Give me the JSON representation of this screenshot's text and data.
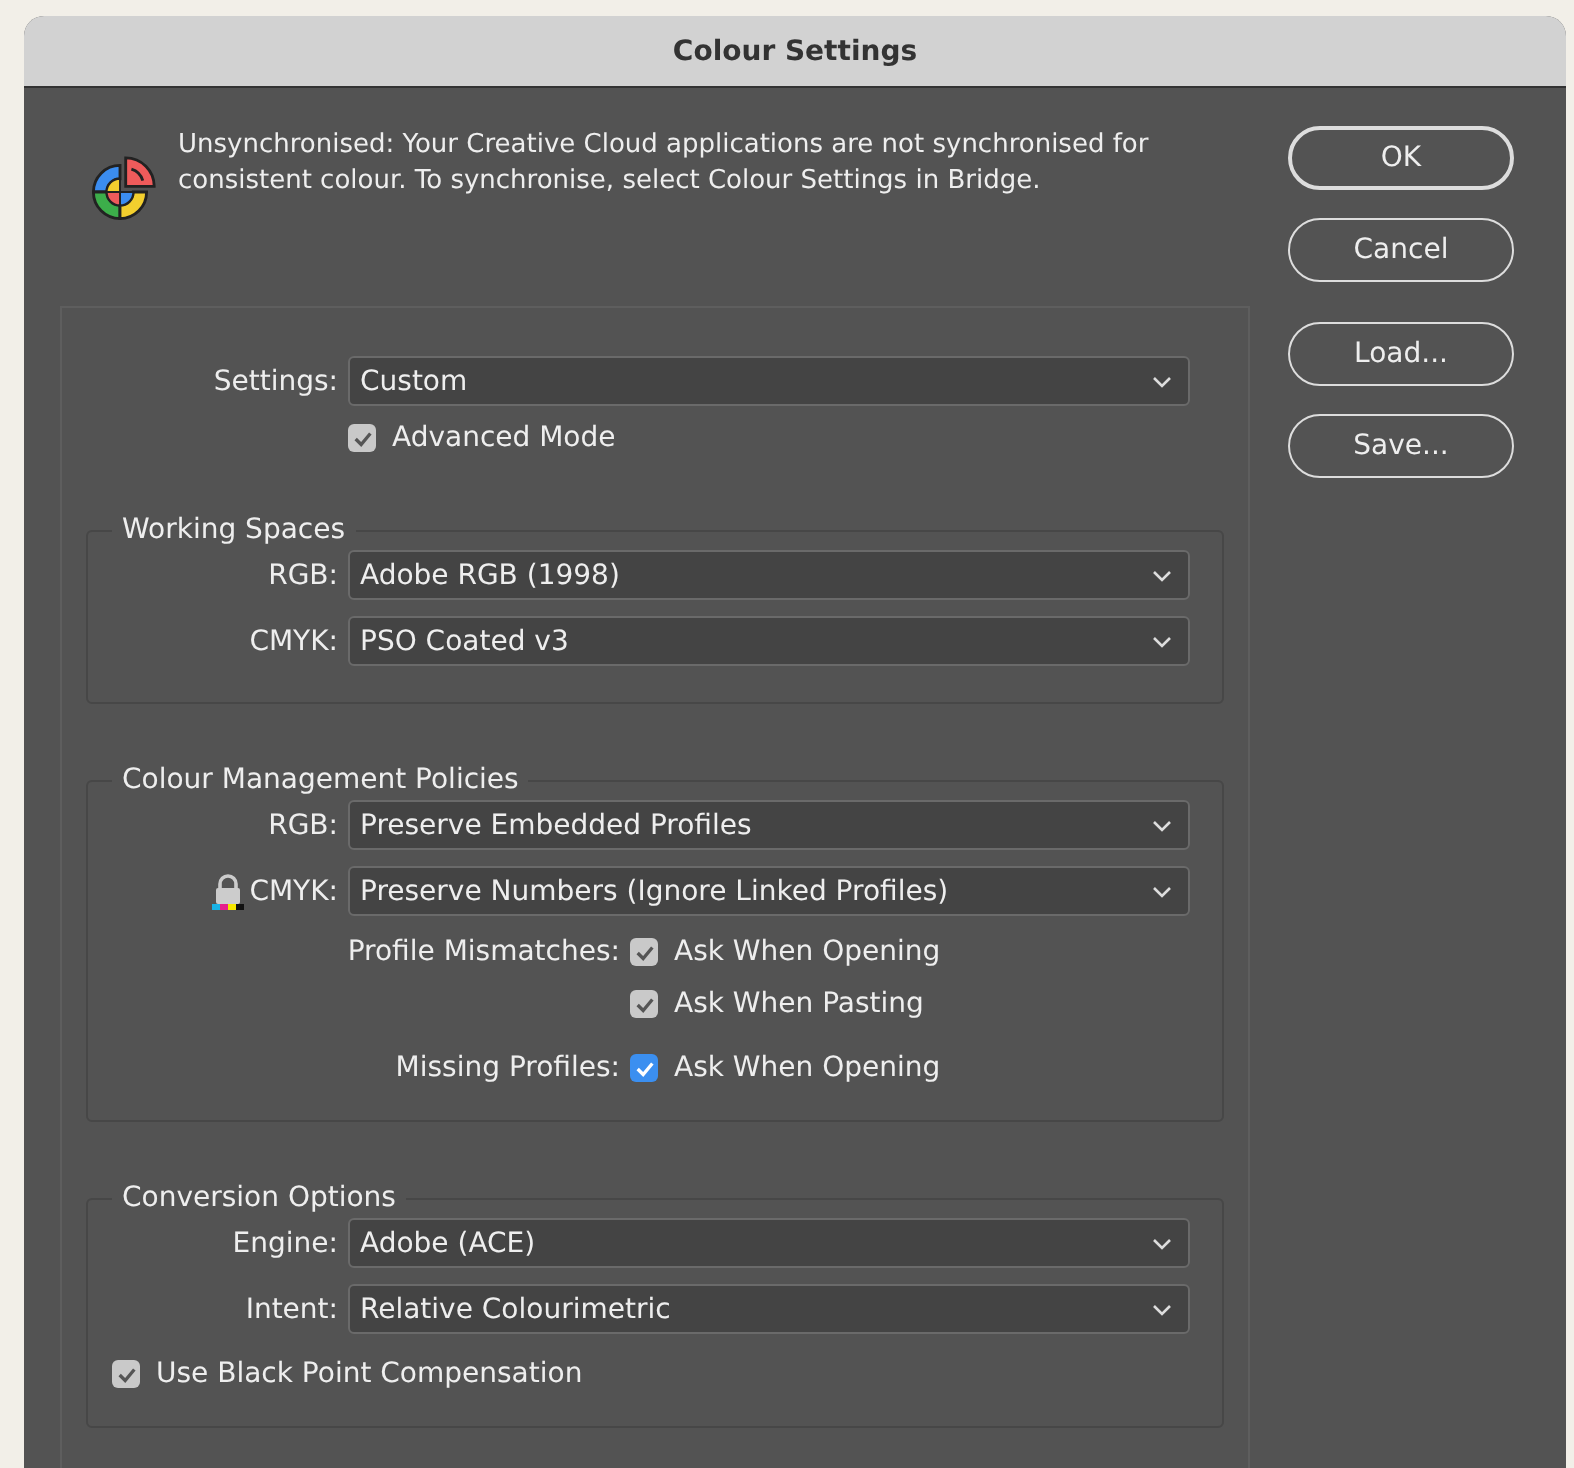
{
  "window": {
    "title": "Colour Settings"
  },
  "message": "Unsynchronised: Your Creative Cloud applications are not synchronised for consistent colour. To synchronise, select Colour Settings in Bridge.",
  "buttons": [
    {
      "label": "OK",
      "default": true
    },
    {
      "label": "Cancel",
      "default": false
    },
    {
      "label": "Load...",
      "default": false
    },
    {
      "label": "Save...",
      "default": false
    }
  ],
  "settings": {
    "label": "Settings:",
    "value": "Custom"
  },
  "advanced_mode": {
    "label": "Advanced Mode",
    "checked": true,
    "focused": false
  },
  "groups": [
    {
      "title": "Working Spaces",
      "rows": [
        {
          "kind": "select",
          "label": "RGB:",
          "value": "Adobe RGB (1998)",
          "locked": false
        },
        {
          "kind": "select",
          "label": "CMYK:",
          "value": "PSO Coated v3",
          "locked": false
        }
      ]
    },
    {
      "title": "Colour Management Policies",
      "rows": [
        {
          "kind": "select",
          "label": "RGB:",
          "value": "Preserve Embedded Profiles",
          "locked": false
        },
        {
          "kind": "select",
          "label": "CMYK:",
          "value": "Preserve Numbers (Ignore Linked Profiles)",
          "locked": true
        },
        {
          "kind": "checkbox",
          "label": "Profile Mismatches:",
          "text": "Ask When Opening",
          "checked": true,
          "focused": false
        },
        {
          "kind": "checkbox",
          "text": "Ask When Pasting",
          "checked": true,
          "focused": false
        },
        {
          "kind": "checkbox",
          "label": "Missing Profiles:",
          "text": "Ask When Opening",
          "checked": true,
          "focused": true
        }
      ]
    },
    {
      "title": "Conversion Options",
      "rows": [
        {
          "kind": "select",
          "label": "Engine:",
          "value": "Adobe (ACE)",
          "locked": false
        },
        {
          "kind": "select",
          "label": "Intent:",
          "value": "Relative Colourimetric",
          "locked": false
        },
        {
          "kind": "option",
          "text": "Use Black Point Compensation",
          "checked": true,
          "focused": false
        }
      ]
    }
  ]
}
